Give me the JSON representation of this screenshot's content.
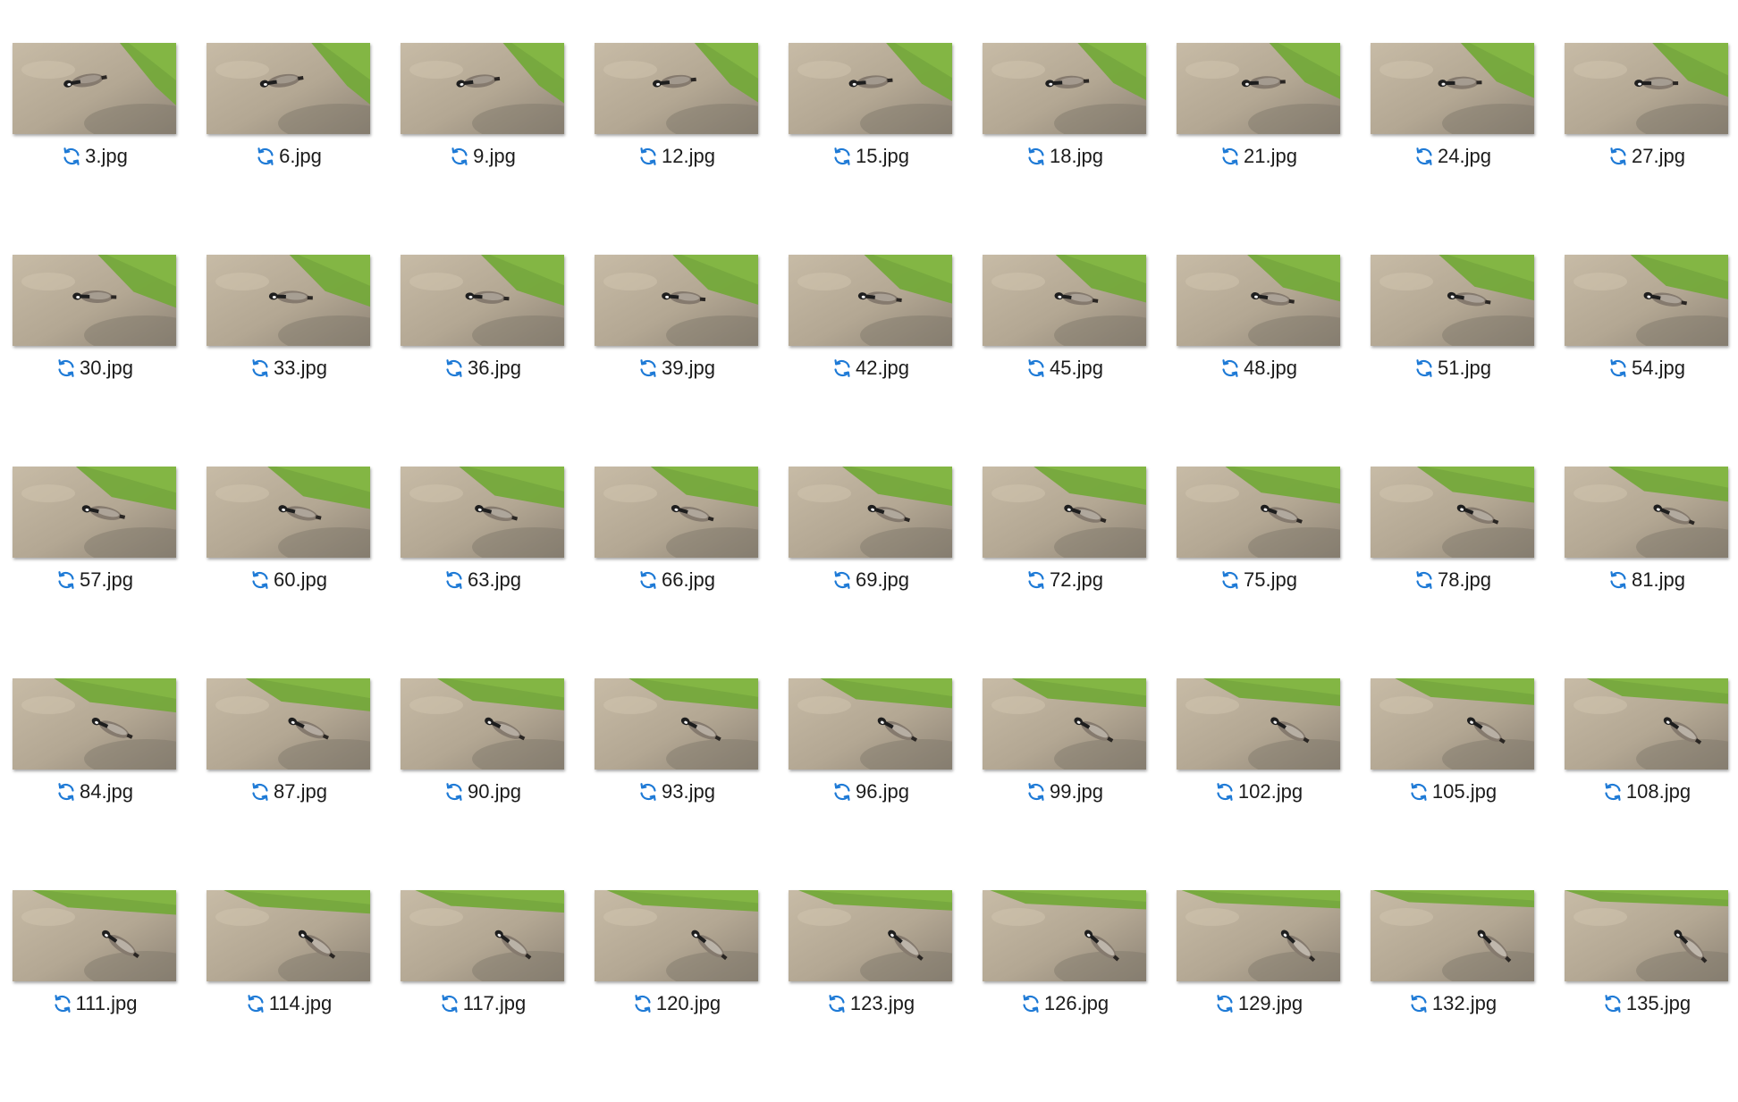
{
  "colors": {
    "sync_icon": "#1e7ad6",
    "label_text": "#1b1b1b",
    "ground_light": "#c7bba6",
    "ground_dark": "#8e8476",
    "grass": "#74a93a",
    "goose_body": "#857a6e",
    "goose_head": "#1e1e1e"
  },
  "status_icon": "sync-icon",
  "files": [
    {
      "name": "3.jpg"
    },
    {
      "name": "6.jpg"
    },
    {
      "name": "9.jpg"
    },
    {
      "name": "12.jpg"
    },
    {
      "name": "15.jpg"
    },
    {
      "name": "18.jpg"
    },
    {
      "name": "21.jpg"
    },
    {
      "name": "24.jpg"
    },
    {
      "name": "27.jpg"
    },
    {
      "name": "30.jpg"
    },
    {
      "name": "33.jpg"
    },
    {
      "name": "36.jpg"
    },
    {
      "name": "39.jpg"
    },
    {
      "name": "42.jpg"
    },
    {
      "name": "45.jpg"
    },
    {
      "name": "48.jpg"
    },
    {
      "name": "51.jpg"
    },
    {
      "name": "54.jpg"
    },
    {
      "name": "57.jpg"
    },
    {
      "name": "60.jpg"
    },
    {
      "name": "63.jpg"
    },
    {
      "name": "66.jpg"
    },
    {
      "name": "69.jpg"
    },
    {
      "name": "72.jpg"
    },
    {
      "name": "75.jpg"
    },
    {
      "name": "78.jpg"
    },
    {
      "name": "81.jpg"
    },
    {
      "name": "84.jpg"
    },
    {
      "name": "87.jpg"
    },
    {
      "name": "90.jpg"
    },
    {
      "name": "93.jpg"
    },
    {
      "name": "96.jpg"
    },
    {
      "name": "99.jpg"
    },
    {
      "name": "102.jpg"
    },
    {
      "name": "105.jpg"
    },
    {
      "name": "108.jpg"
    },
    {
      "name": "111.jpg"
    },
    {
      "name": "114.jpg"
    },
    {
      "name": "117.jpg"
    },
    {
      "name": "120.jpg"
    },
    {
      "name": "123.jpg"
    },
    {
      "name": "126.jpg"
    },
    {
      "name": "129.jpg"
    },
    {
      "name": "132.jpg"
    },
    {
      "name": "135.jpg"
    }
  ]
}
